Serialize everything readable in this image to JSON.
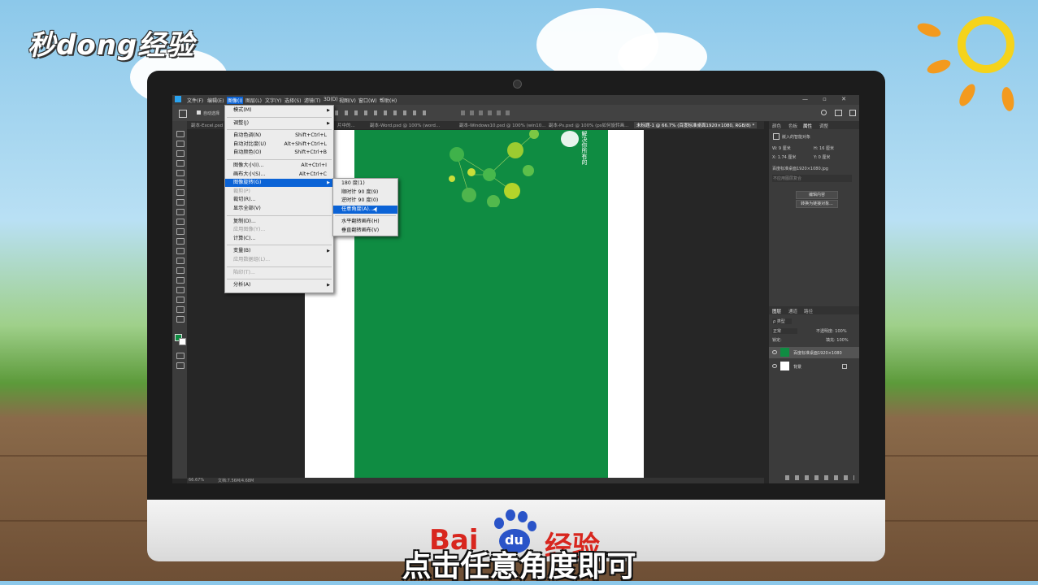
{
  "watermark": "秒dong经验",
  "subtitle": "点击任意角度即可",
  "logo": {
    "left": "Bai",
    "paw": "du",
    "right": "经验"
  },
  "colors": {
    "accent": "#0b63d6",
    "canvas_green": "#0f8c42",
    "logo_red": "#d8261e",
    "logo_blue": "#2a54c8",
    "sun": "#f39a1e"
  },
  "app": {
    "menubar": [
      "文件(F)",
      "编辑(E)",
      "图像(I)",
      "图层(L)",
      "文字(Y)",
      "选择(S)",
      "滤镜(T)",
      "3D(D)",
      "视图(V)",
      "窗口(W)",
      "帮助(H)"
    ],
    "window_controls": "— ▫ ✕",
    "options_left": "自动选择",
    "tabs": [
      "副本-Excel.psd ...",
      "片中的...",
      "副本-Word.psd @ 100% (word...",
      "副本-Windows10.psd @ 100% (win10...",
      "副本-Ps.psd @ 100% (ps如何旋转画...",
      "未标题-1 @ 66.7% (百度标准桌面1920×1080, RGB/8) *"
    ],
    "status": {
      "zoom": "66.67%",
      "doc": "文档:7.56M/4.68M"
    },
    "canvas_text": "解决你所有的"
  },
  "image_menu": [
    {
      "label": "模式(M)",
      "submenu": true
    },
    {
      "sep": true
    },
    {
      "label": "调整(J)",
      "submenu": true
    },
    {
      "sep": true
    },
    {
      "label": "自动色调(N)",
      "shortcut": "Shift+Ctrl+L"
    },
    {
      "label": "自动对比度(U)",
      "shortcut": "Alt+Shift+Ctrl+L"
    },
    {
      "label": "自动颜色(O)",
      "shortcut": "Shift+Ctrl+B"
    },
    {
      "sep": true
    },
    {
      "label": "图像大小(I)...",
      "shortcut": "Alt+Ctrl+I"
    },
    {
      "label": "画布大小(S)...",
      "shortcut": "Alt+Ctrl+C"
    },
    {
      "label": "图像旋转(G)",
      "submenu": true,
      "selected": true
    },
    {
      "label": "裁剪(P)",
      "disabled": true
    },
    {
      "label": "裁切(R)..."
    },
    {
      "label": "显示全部(V)"
    },
    {
      "sep": true
    },
    {
      "label": "复制(D)..."
    },
    {
      "label": "应用图像(Y)...",
      "disabled": true
    },
    {
      "label": "计算(C)..."
    },
    {
      "sep": true
    },
    {
      "label": "变量(B)",
      "submenu": true
    },
    {
      "label": "应用数据组(L)...",
      "disabled": true
    },
    {
      "sep": true
    },
    {
      "label": "陷印(T)...",
      "disabled": true
    },
    {
      "sep": true
    },
    {
      "label": "分析(A)",
      "submenu": true
    }
  ],
  "rotate_submenu": [
    {
      "label": "180 度(1)"
    },
    {
      "label": "顺时针 90 度(9)"
    },
    {
      "label": "逆时针 90 度(0)"
    },
    {
      "label": "任意角度(A)...",
      "selected": true
    },
    {
      "sep": true
    },
    {
      "label": "水平翻转画布(H)"
    },
    {
      "label": "垂直翻转画布(V)"
    }
  ],
  "properties_panel": {
    "tabs": [
      "颜色",
      "色板",
      "属性",
      "调整"
    ],
    "title": "嵌入的智能对象",
    "w": "W: 9 厘米",
    "h": "H: 16 厘米",
    "x": "X: 1.74 厘米",
    "y": "Y: 0 厘米",
    "file": "百度标准桌面1920×1080.jpg",
    "placeholder": "不应用图层复合",
    "btn_edit": "编辑内容",
    "btn_convert": "转换为链接对象..."
  },
  "layers_panel": {
    "tabs": [
      "图层",
      "通道",
      "路径"
    ],
    "filter": "ρ 类型",
    "mode": "正常",
    "opacity": "不透明度: 100%",
    "lock": "锁定:",
    "fill": "填充: 100%",
    "layers": [
      "百度标准桌面1920×1080",
      "背景"
    ]
  }
}
